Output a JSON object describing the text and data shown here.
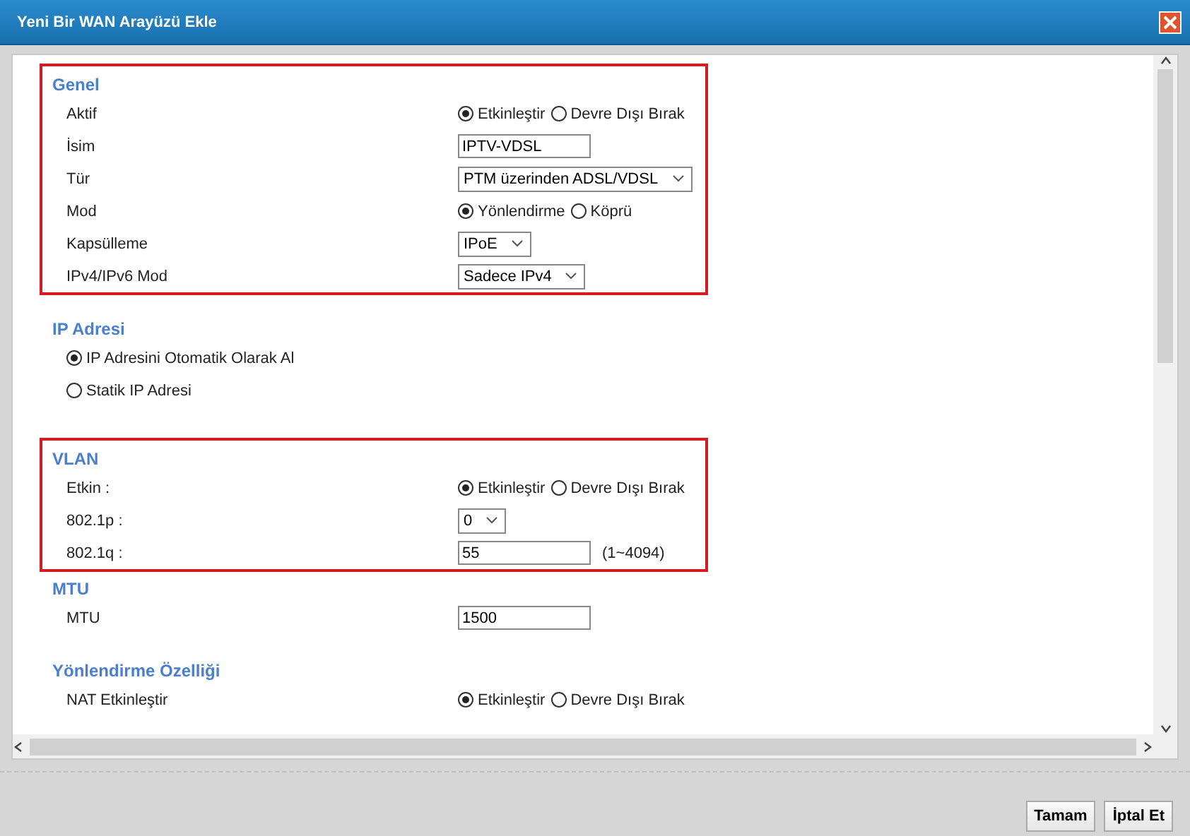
{
  "window": {
    "title": "Yeni Bir WAN Arayüzü Ekle"
  },
  "sections": [
    {
      "title": "Genel",
      "highlighted": true,
      "rows": [
        {
          "kind": "radio",
          "label": "Aktif",
          "options": [
            {
              "label": "Etkinleştir",
              "selected": true
            },
            {
              "label": "Devre Dışı Bırak",
              "selected": false
            }
          ]
        },
        {
          "kind": "text",
          "label": "İsim",
          "value": "IPTV-VDSL"
        },
        {
          "kind": "select",
          "label": "Tür",
          "value": "PTM üzerinden ADSL/VDSL"
        },
        {
          "kind": "radio",
          "label": "Mod",
          "options": [
            {
              "label": "Yönlendirme",
              "selected": true
            },
            {
              "label": "Köprü",
              "selected": false
            }
          ]
        },
        {
          "kind": "select",
          "label": "Kapsülleme",
          "value": "IPoE"
        },
        {
          "kind": "select",
          "label": "IPv4/IPv6 Mod",
          "value": "Sadece IPv4"
        }
      ]
    },
    {
      "title": "IP Adresi",
      "highlighted": false,
      "rows": [
        {
          "kind": "choice",
          "label": "IP Adresini Otomatik Olarak Al",
          "selected": true
        },
        {
          "kind": "choice",
          "label": "Statik IP Adresi",
          "selected": false
        }
      ]
    },
    {
      "title": "VLAN",
      "highlighted": true,
      "rows": [
        {
          "kind": "radio",
          "label": "Etkin :",
          "options": [
            {
              "label": "Etkinleştir",
              "selected": true
            },
            {
              "label": "Devre Dışı Bırak",
              "selected": false
            }
          ]
        },
        {
          "kind": "select",
          "label": "802.1p :",
          "value": "0"
        },
        {
          "kind": "text",
          "label": "802.1q :",
          "value": "55",
          "hint": "(1~4094)"
        }
      ]
    },
    {
      "title": "MTU",
      "highlighted": false,
      "rows": [
        {
          "kind": "text",
          "label": "MTU",
          "value": "1500"
        }
      ]
    },
    {
      "title": "Yönlendirme Özelliği",
      "highlighted": false,
      "rows": [
        {
          "kind": "radio",
          "label": "NAT Etkinleştir",
          "options": [
            {
              "label": "Etkinleştir",
              "selected": true
            },
            {
              "label": "Devre Dışı Bırak",
              "selected": false
            }
          ]
        }
      ]
    }
  ],
  "buttons": [
    "Tamam",
    "İptal Et"
  ]
}
